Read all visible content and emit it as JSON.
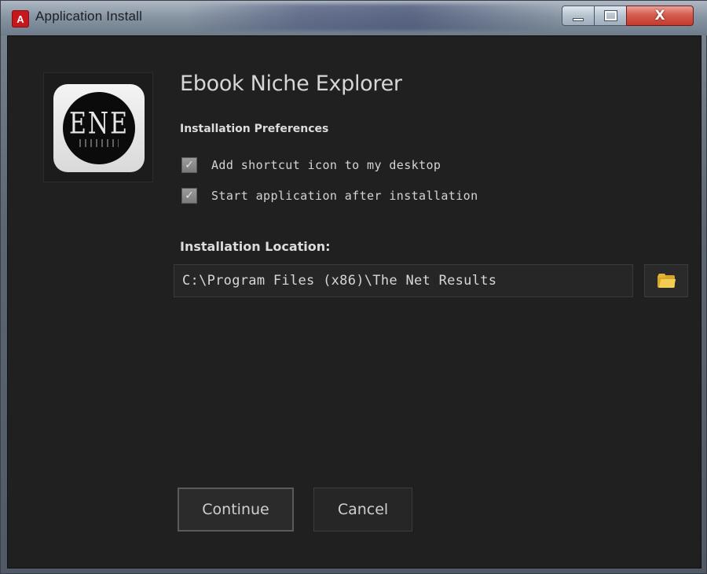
{
  "window": {
    "title": "Application Install",
    "badge_letter": "A",
    "controls": {
      "minimize_icon": "minimize-icon",
      "maximize_icon": "maximize-icon",
      "close_glyph": "X"
    }
  },
  "app": {
    "name": "Ebook Niche Explorer",
    "logo_text": "ENE"
  },
  "preferences": {
    "heading": "Installation Preferences",
    "options": [
      {
        "label": "Add shortcut icon to my desktop",
        "checked": true
      },
      {
        "label": "Start application after installation",
        "checked": true
      }
    ]
  },
  "location": {
    "heading": "Installation Location:",
    "path": "C:\\Program Files (x86)\\The Net Results",
    "browse_icon": "folder-icon"
  },
  "actions": {
    "continue_label": "Continue",
    "cancel_label": "Cancel"
  },
  "colors": {
    "background": "#202020",
    "text": "#d6d6d6",
    "badge": "#c8161d",
    "close": "#c33a2b",
    "folder": "#f3cc52"
  }
}
